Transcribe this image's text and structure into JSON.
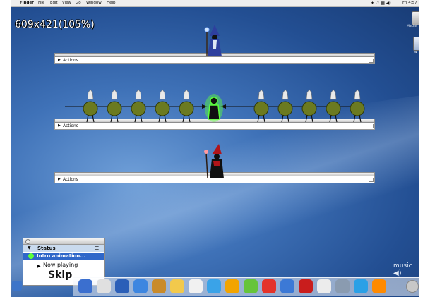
{
  "menubar": {
    "apple": "",
    "items": [
      "Finder",
      "File",
      "Edit",
      "View",
      "Go",
      "Window",
      "Help"
    ],
    "clock": "Fri 4:57"
  },
  "resolution_label": "609x421(105%)",
  "desktop": {
    "labels": [
      "Macint",
      "w"
    ]
  },
  "shelves": {
    "top": {
      "label": "Actions"
    },
    "middle": {
      "label": "Actions"
    },
    "bottom": {
      "label": "Actions"
    }
  },
  "status_panel": {
    "header": "Status",
    "current_item": "Intro animation...",
    "now_playing": "Now playing",
    "skip": "Skip"
  },
  "music": {
    "label": "music"
  },
  "colors": {
    "desktop": "#3f72b8",
    "selection": "#2f67c9",
    "shield": "#6b7a20",
    "glow": "#5cff3a"
  }
}
